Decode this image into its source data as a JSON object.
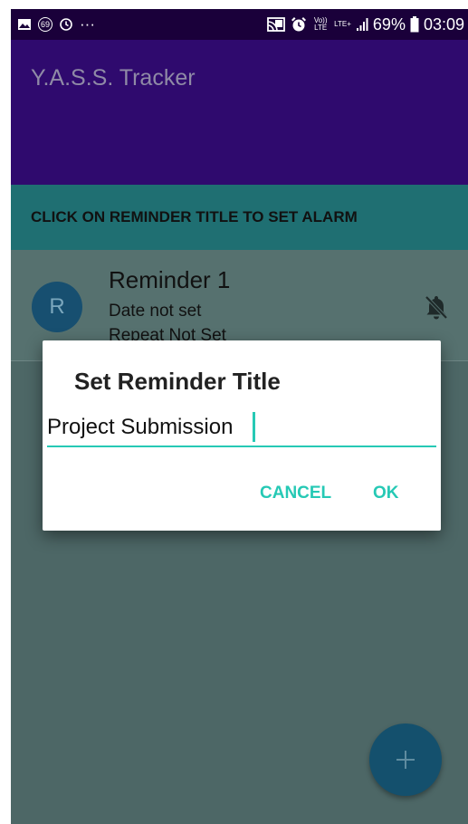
{
  "status_bar": {
    "notification_count": "69",
    "overflow": "···",
    "volte_label": "Vo)) LTE",
    "lte_label": "LTE+",
    "battery_text": "69%",
    "time": "03:09"
  },
  "app_bar": {
    "title": "Y.A.S.S. Tracker"
  },
  "banner": {
    "text": "CLICK ON REMINDER TITLE TO SET ALARM"
  },
  "reminders": [
    {
      "avatar_letter": "R",
      "title": "Reminder 1",
      "date": "Date not set",
      "repeat": "Repeat Not Set",
      "icon": "bell-off-icon"
    }
  ],
  "dialog": {
    "title": "Set Reminder Title",
    "input_value": "Project Submission",
    "cancel_label": "CANCEL",
    "ok_label": "OK"
  },
  "fab": {
    "label": "+"
  },
  "colors": {
    "status_bar": "#1a003a",
    "app_bar": "#2f0a6e",
    "banner": "#1f6f72",
    "content_dimmed": "#4d6766",
    "accent": "#26c9b5",
    "fab": "#14506d"
  }
}
